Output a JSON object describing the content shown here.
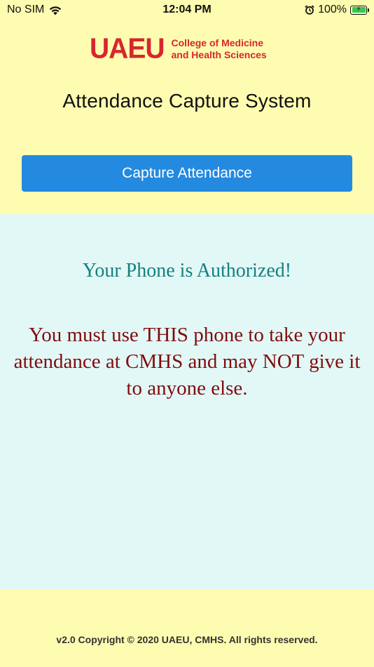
{
  "status_bar": {
    "carrier": "No SIM",
    "time": "12:04 PM",
    "battery_percent": "100%",
    "battery_level": 1.0,
    "icons": [
      "wifi-icon",
      "alarm-icon",
      "battery-charging-icon"
    ]
  },
  "logo": {
    "main": "UAEU",
    "sub_line1": "College of Medicine",
    "sub_line2": "and Health Sciences"
  },
  "header": {
    "title": "Attendance Capture System"
  },
  "actions": {
    "capture_label": "Capture Attendance"
  },
  "message": {
    "authorized": "Your Phone is Authorized!",
    "warning": "You must use THIS phone to take your attendance at CMHS and may NOT give it to anyone else."
  },
  "footer": {
    "copyright": "v2.0 Copyright © 2020 UAEU, CMHS. All rights reserved."
  },
  "colors": {
    "background": "#fefcb0",
    "panel": "#e2f8f7",
    "button": "#238ae0",
    "logo_red": "#d7262f",
    "authorized_teal": "#14807f",
    "warning_red": "#800d0d"
  }
}
